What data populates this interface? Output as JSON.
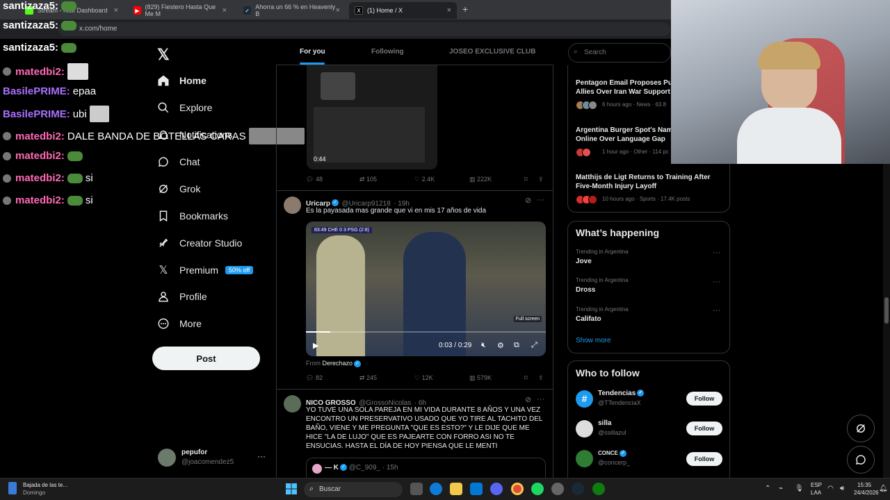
{
  "browser": {
    "tabs": [
      {
        "title": "Stream - Kick Dashboard",
        "color": "#53fc18"
      },
      {
        "title": "(829) Fiestero Hasta Que Me M",
        "color": "#ff0000"
      },
      {
        "title": "Ahorra un 66 % en Heavenly B",
        "color": "#1b2838"
      },
      {
        "title": "(1) Home / X",
        "color": "#000000"
      }
    ],
    "url": "x.com/home"
  },
  "chat": [
    {
      "user": "santizaza5:",
      "color": "#ffffff",
      "msg": ""
    },
    {
      "user": "santizaza5:",
      "color": "#ffffff",
      "msg": ""
    },
    {
      "user": "santizaza5:",
      "color": "#ffffff",
      "msg": ""
    },
    {
      "user": "matedbi2:",
      "color": "#ff69b4",
      "msg": ""
    },
    {
      "user": "BasilePRIME:",
      "color": "#a970ff",
      "msg": "epaa"
    },
    {
      "user": "BasilePRIME:",
      "color": "#a970ff",
      "msg": "ubi"
    },
    {
      "user": "matedbi2:",
      "color": "#ff69b4",
      "msg": "DALE BANDA DE BOTELLAS CARAS"
    },
    {
      "user": "matedbi2:",
      "color": "#ff69b4",
      "msg": ""
    },
    {
      "user": "matedbi2:",
      "color": "#ff69b4",
      "msg": "si"
    },
    {
      "user": "matedbi2:",
      "color": "#ff69b4",
      "msg": "si"
    }
  ],
  "nav": {
    "items": [
      {
        "label": "Home",
        "icon": "home-icon"
      },
      {
        "label": "Explore",
        "icon": "search-icon"
      },
      {
        "label": "Notifications",
        "icon": "bell-icon"
      },
      {
        "label": "Chat",
        "icon": "chat-icon"
      },
      {
        "label": "Grok",
        "icon": "grok-icon"
      },
      {
        "label": "Bookmarks",
        "icon": "bookmark-icon"
      },
      {
        "label": "Creator Studio",
        "icon": "rocket-icon"
      },
      {
        "label": "Premium",
        "icon": "x-icon"
      },
      {
        "label": "Profile",
        "icon": "person-icon"
      },
      {
        "label": "More",
        "icon": "more-icon"
      }
    ],
    "premium_badge": "50% off",
    "post_label": "Post",
    "account": {
      "name": "pepufor",
      "handle": "@joacomendez5"
    }
  },
  "feed": {
    "tabs": [
      "For you",
      "Following",
      "JOSEO EXCLUSIVE CLUB"
    ],
    "post1": {
      "duration": "0:44",
      "replies": "48",
      "reposts": "105",
      "likes": "2.4K",
      "views": "222K"
    },
    "post2": {
      "name": "Uricarp",
      "handle": "@Uricarp91218",
      "time": "· 19h",
      "text": "Es la payasada mas grande que vi en mis 17 años de vida",
      "score": "83:49  CHE  0  3  PSG  (2:8)",
      "fullscreen": "Full screen",
      "time_current": "0:03",
      "time_total": "0:29",
      "progress": 0.1,
      "from_label": "From",
      "from_name": "Derechazo",
      "replies": "82",
      "reposts": "245",
      "likes": "12K",
      "views": "579K"
    },
    "post3": {
      "name": "NICO GROSSO",
      "handle": "@GrossoNicolas",
      "time": "· 6h",
      "text": "YO TUVE UNA SOLA PAREJA EN MI VIDA DURANTE 8 AÑOS Y UNA VEZ ENCONTRO UN PRESERVATIVO USADO QUE YO TIRE AL TACHITO DEL BAÑO, VIENE Y ME PREGUNTA \"QUE ES ESTO?\" Y LE DIJE QUE ME HICE \"LA DE LUJO\" QUE ES PAJEARTE CON FORRO ASI NO TE ENSUCIAS. HASTA EL DÍA DE HOY PIENSA QUE LE MENTI",
      "quote_name": "— K",
      "quote_handle": "@C_909_",
      "quote_time": "· 15h"
    }
  },
  "right": {
    "search_placeholder": "Search",
    "news": [
      {
        "title": "Pentagon Email Proposes Pu... Allies Over Iran War Support",
        "l1": "Pentagon Email Proposes Pu",
        "l2": "Allies Over Iran War Support",
        "meta": "6 hours ago · News · 63.8"
      },
      {
        "title": "",
        "l1": "Argentina Burger Spot's Nam",
        "l2": "Online Over Language Gap",
        "meta": "1 hour ago · Other · 114 pc"
      },
      {
        "title": "",
        "l1": "Matthijs de Ligt Returns to Training After",
        "l2": "Five-Month Injury Layoff",
        "meta": "10 hours ago · Sports · 17.4K posts"
      }
    ],
    "happening_title": "What’s happening",
    "trends": [
      {
        "context": "Trending in Argentina",
        "name": "Jove"
      },
      {
        "context": "Trending in Argentina",
        "name": "Dross"
      },
      {
        "context": "Trending in Argentina",
        "name": "Califato"
      }
    ],
    "show_more": "Show more",
    "wtf_title": "Who to follow",
    "follow_label": "Follow",
    "suggestions": [
      {
        "name": "Tendencias",
        "handle": "@TTendenciaX",
        "verified": true,
        "color": "#1d9bf0"
      },
      {
        "name": "silla",
        "handle": "@ssillazul",
        "verified": false,
        "color": "#dddddd"
      },
      {
        "name": "CONCE",
        "handle": "@concerp_",
        "verified": true,
        "color": "#2e7d32"
      }
    ]
  },
  "taskbar": {
    "media_title": "Bajada de las te...",
    "media_sub": "Domingo",
    "search": "Buscar",
    "lang1": "ESP",
    "lang2": "LAA",
    "time": "15:35",
    "date": "24/4/2026"
  }
}
